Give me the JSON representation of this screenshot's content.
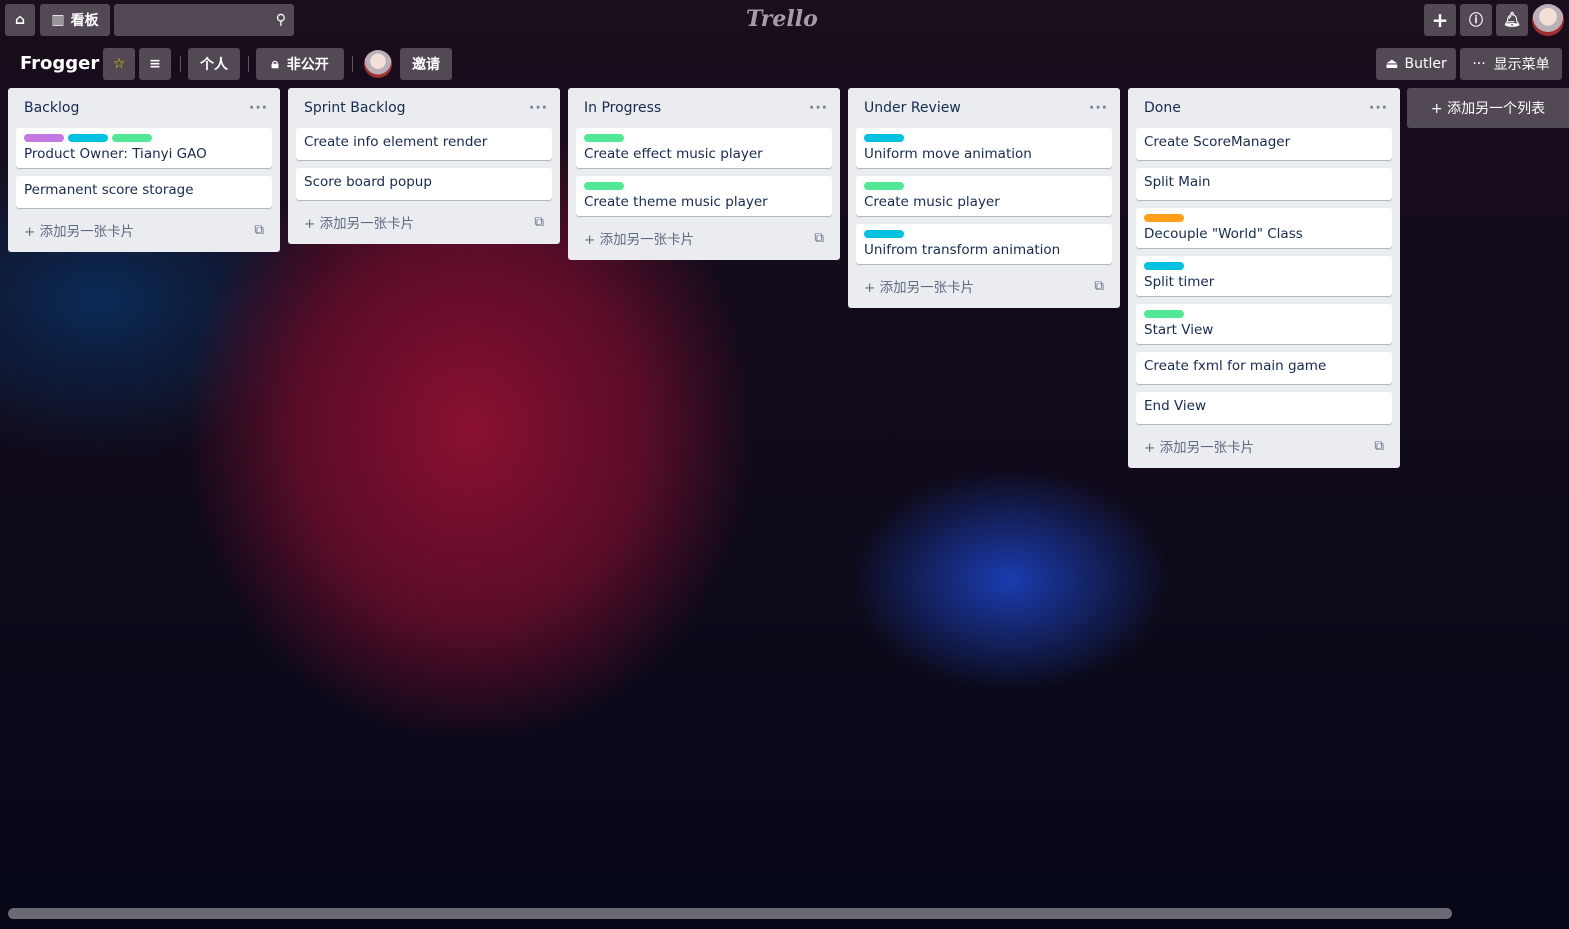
{
  "topbar": {
    "boards_label": "看板",
    "search_placeholder": "",
    "logo": "Trello"
  },
  "board": {
    "title": "Frogger",
    "visibility_team": "个人",
    "privacy": "非公开",
    "invite": "邀请",
    "butler": "Butler",
    "show_menu": "显示菜单",
    "add_list": "+ 添加另一个列表",
    "star_color": "#f2d600"
  },
  "lists": [
    {
      "title": "Backlog",
      "cards": [
        {
          "title": "Product Owner: Tianyi GAO",
          "labels": [
            "#c377e0",
            "#00c2e0",
            "#51e898"
          ]
        },
        {
          "title": "Permanent score storage",
          "labels": []
        }
      ]
    },
    {
      "title": "Sprint Backlog",
      "cards": [
        {
          "title": "Create info element render",
          "labels": []
        },
        {
          "title": "Score board popup",
          "labels": []
        }
      ]
    },
    {
      "title": "In Progress",
      "cards": [
        {
          "title": "Create effect music player",
          "labels": [
            "#51e898"
          ]
        },
        {
          "title": "Create theme music player",
          "labels": [
            "#51e898"
          ]
        }
      ]
    },
    {
      "title": "Under Review",
      "cards": [
        {
          "title": "Uniform move animation",
          "labels": [
            "#00c2e0"
          ]
        },
        {
          "title": "Create music player",
          "labels": [
            "#51e898"
          ]
        },
        {
          "title": "Unifrom transform animation",
          "labels": [
            "#00c2e0"
          ]
        }
      ]
    },
    {
      "title": "Done",
      "cards": [
        {
          "title": "Create ScoreManager",
          "labels": []
        },
        {
          "title": "Split Main",
          "labels": []
        },
        {
          "title": "Decouple \"World\" Class",
          "labels": [
            "#ff9f1a"
          ]
        },
        {
          "title": "Split timer",
          "labels": [
            "#00c2e0"
          ]
        },
        {
          "title": "Start View",
          "labels": [
            "#51e898"
          ]
        },
        {
          "title": "Create fxml for main game",
          "labels": []
        },
        {
          "title": "End View",
          "labels": []
        }
      ]
    }
  ],
  "add_card_label": "添加另一张卡片"
}
